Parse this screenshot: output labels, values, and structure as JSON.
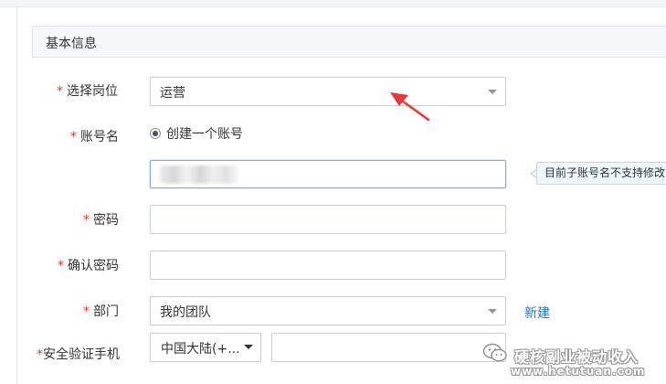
{
  "section": {
    "title": "基本信息"
  },
  "form": {
    "required_mark": "*",
    "position": {
      "label": "选择岗位",
      "value": "运营"
    },
    "account": {
      "label": "账号名",
      "radio_label": "创建一个账号",
      "tooltip": "目前子账号名不支持修改"
    },
    "password": {
      "label": "密码"
    },
    "confirm_password": {
      "label": "确认密码"
    },
    "department": {
      "label": "部门",
      "value": "我的团队",
      "new_link": "新建"
    },
    "phone": {
      "label": "安全验证手机",
      "country_code": "中国大陆(+..."
    }
  },
  "watermark": {
    "title": "硬核副业被动收入",
    "url": "www.hetutuan.com"
  },
  "colors": {
    "required": "#e4393c",
    "link": "#2a76c9",
    "annotation_arrow": "#e8393a",
    "focus_border": "#75aee4"
  },
  "icons": {
    "select_caret": "chevron-down-icon",
    "radio": "radio-checked-icon",
    "wechat": "wechat-icon"
  }
}
